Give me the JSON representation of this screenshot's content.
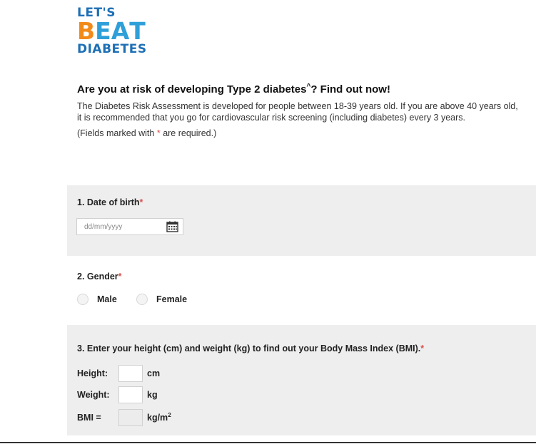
{
  "logo": {
    "line1": "LET'S",
    "line2_b": "B",
    "line2_e": "E",
    "line2_a": "A",
    "line2_t": "T",
    "line3": "DIABETES"
  },
  "intro": {
    "heading": "Are you at risk of developing Type 2 diabetes",
    "heading_sup": "^",
    "heading_tail": "? Find out now!",
    "description": "The Diabetes Risk Assessment is developed for people between 18-39 years old. If you are above 40 years old, it is recommended that you go for cardiovascular risk screening (including diabetes) every 3 years.",
    "required_prefix": "(Fields marked with ",
    "required_star": "*",
    "required_suffix": " are required.)"
  },
  "q1": {
    "label": "1. Date of birth",
    "star": "*",
    "placeholder": "dd/mm/yyyy",
    "icon": "calendar-icon"
  },
  "q2": {
    "label": "2. Gender",
    "star": "*",
    "options": [
      "Male",
      "Female"
    ]
  },
  "q3": {
    "label": "3. Enter your height (cm) and weight (kg) to find out your Body Mass Index (BMI).",
    "star": "*",
    "height_label": "Height:",
    "height_unit": "cm",
    "weight_label": "Weight:",
    "weight_unit": "kg",
    "bmi_label": "BMI =",
    "bmi_unit": "kg/m",
    "bmi_unit_sup": "2"
  }
}
